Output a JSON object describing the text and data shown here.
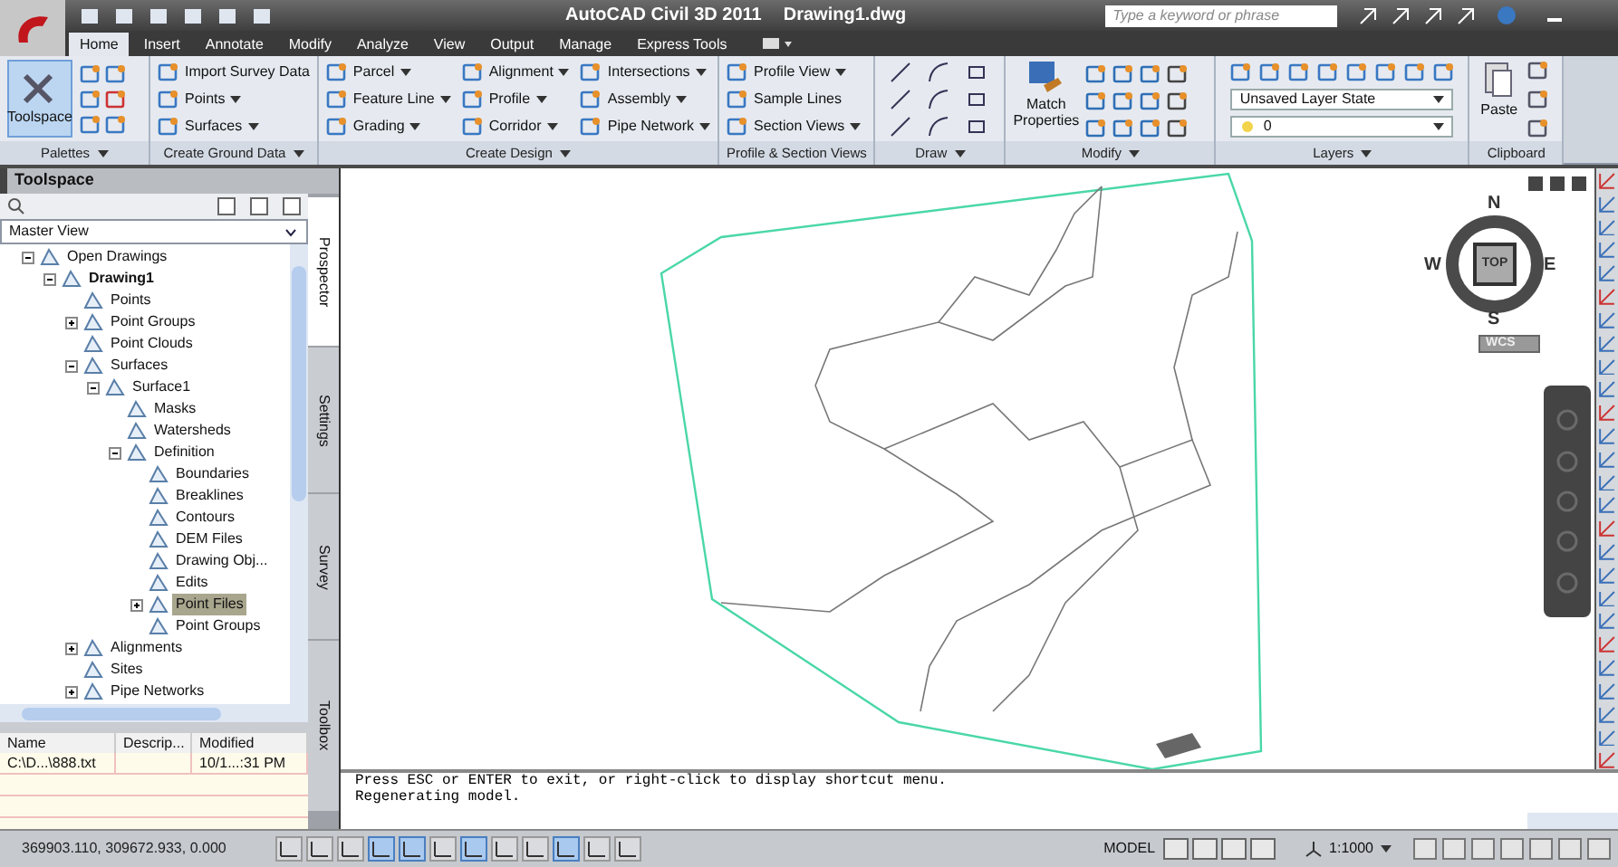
{
  "title_bar": {
    "product": "AutoCAD Civil 3D 2011",
    "document": "Drawing1.dwg",
    "search": {
      "placeholder": "Type a keyword or phrase"
    }
  },
  "ribbon_tabs": [
    {
      "label": "Home",
      "selected": true
    },
    {
      "label": "Insert",
      "selected": false
    },
    {
      "label": "Annotate",
      "selected": false
    },
    {
      "label": "Modify",
      "selected": false
    },
    {
      "label": "Analyze",
      "selected": false
    },
    {
      "label": "View",
      "selected": false
    },
    {
      "label": "Output",
      "selected": false
    },
    {
      "label": "Manage",
      "selected": false
    },
    {
      "label": "Express Tools",
      "selected": false
    }
  ],
  "ribbon_panels": [
    {
      "title": "Palettes",
      "expandable": true,
      "kind": "palettes",
      "large": {
        "label": "Toolspace"
      }
    },
    {
      "title": "Create Ground Data",
      "expandable": true,
      "kind": "list",
      "columns": [
        [
          {
            "label": "Import Survey Data",
            "dropdown": false
          },
          {
            "label": "Points",
            "dropdown": true
          },
          {
            "label": "Surfaces",
            "dropdown": true
          }
        ]
      ]
    },
    {
      "title": "Create Design",
      "expandable": true,
      "kind": "list",
      "columns": [
        [
          {
            "label": "Parcel",
            "dropdown": true
          },
          {
            "label": "Feature Line",
            "dropdown": true
          },
          {
            "label": "Grading",
            "dropdown": true
          }
        ],
        [
          {
            "label": "Alignment",
            "dropdown": true
          },
          {
            "label": "Profile",
            "dropdown": true
          },
          {
            "label": "Corridor",
            "dropdown": true
          }
        ],
        [
          {
            "label": "Intersections",
            "dropdown": true
          },
          {
            "label": "Assembly",
            "dropdown": true
          },
          {
            "label": "Pipe Network",
            "dropdown": true
          }
        ]
      ]
    },
    {
      "title": "Profile & Section Views",
      "expandable": false,
      "kind": "list",
      "columns": [
        [
          {
            "label": "Profile View",
            "dropdown": true
          },
          {
            "label": "Sample Lines",
            "dropdown": false
          },
          {
            "label": "Section Views",
            "dropdown": true
          }
        ]
      ]
    },
    {
      "title": "Draw",
      "expandable": true,
      "kind": "draw"
    },
    {
      "title": "Modify",
      "expandable": true,
      "kind": "modify",
      "large": {
        "label": "Match Properties"
      }
    },
    {
      "title": "Layers",
      "expandable": true,
      "kind": "layers",
      "combos": [
        "Unsaved Layer State",
        "0"
      ]
    },
    {
      "title": "Clipboard",
      "expandable": false,
      "kind": "clipboard",
      "large": {
        "label": "Paste"
      }
    }
  ],
  "toolspace": {
    "title": "Toolspace",
    "view": "Master View",
    "tree": [
      {
        "label": "Open Drawings",
        "expanded": true,
        "selected": false,
        "children": [
          {
            "label": "Drawing1",
            "expanded": true,
            "selected": false,
            "children": [
              {
                "label": "Points",
                "selected": false
              },
              {
                "label": "Point Groups",
                "expanded": false,
                "selected": false
              },
              {
                "label": "Point Clouds",
                "selected": false
              },
              {
                "label": "Surfaces",
                "expanded": true,
                "selected": false,
                "children": [
                  {
                    "label": "Surface1",
                    "expanded": true,
                    "selected": false,
                    "children": [
                      {
                        "label": "Masks",
                        "selected": false
                      },
                      {
                        "label": "Watersheds",
                        "selected": false
                      },
                      {
                        "label": "Definition",
                        "expanded": true,
                        "selected": false,
                        "children": [
                          {
                            "label": "Boundaries",
                            "selected": false
                          },
                          {
                            "label": "Breaklines",
                            "selected": false
                          },
                          {
                            "label": "Contours",
                            "selected": false
                          },
                          {
                            "label": "DEM Files",
                            "selected": false
                          },
                          {
                            "label": "Drawing Obj...",
                            "selected": false
                          },
                          {
                            "label": "Edits",
                            "selected": false
                          },
                          {
                            "label": "Point Files",
                            "expanded": false,
                            "selected": true
                          },
                          {
                            "label": "Point Groups",
                            "selected": false
                          }
                        ]
                      }
                    ]
                  }
                ]
              },
              {
                "label": "Alignments",
                "expanded": false,
                "selected": false
              },
              {
                "label": "Sites",
                "selected": false
              },
              {
                "label": "Pipe Networks",
                "expanded": false,
                "selected": false
              }
            ]
          }
        ]
      }
    ],
    "side_tabs": [
      {
        "label": "Prospector",
        "selected": true
      },
      {
        "label": "Settings",
        "selected": false
      },
      {
        "label": "Survey",
        "selected": false
      },
      {
        "label": "Toolbox",
        "selected": false
      }
    ],
    "list": {
      "columns": [
        "Name",
        "Descrip...",
        "Modified"
      ],
      "rows": [
        [
          "C:\\D...\\888.txt",
          "",
          "10/1...:31 PM"
        ]
      ]
    }
  },
  "viewcube": {
    "north": "N",
    "east": "E",
    "south": "S",
    "west": "W",
    "face": "TOP",
    "ucs": "WCS"
  },
  "command_line": [
    "Press ESC or ENTER to exit, or right-click to display shortcut menu.",
    "Regenerating model."
  ],
  "status_bar": {
    "coordinates": "369903.110, 309672.933, 0.000",
    "toggles": [
      {
        "on": false
      },
      {
        "on": false
      },
      {
        "on": false
      },
      {
        "on": true
      },
      {
        "on": true
      },
      {
        "on": false
      },
      {
        "on": true
      },
      {
        "on": false
      },
      {
        "on": false
      },
      {
        "on": true
      },
      {
        "on": false
      },
      {
        "on": false
      }
    ],
    "space": "MODEL",
    "scale": "1:1000"
  }
}
